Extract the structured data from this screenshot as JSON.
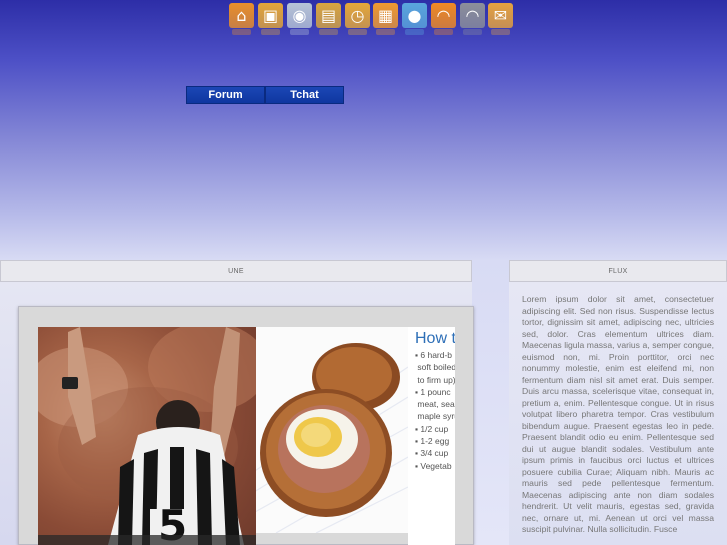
{
  "toolbar": {
    "icons": [
      {
        "name": "home-icon",
        "glyph": "⌂",
        "color": "#e98f2b"
      },
      {
        "name": "briefcase-icon",
        "glyph": "▣",
        "color": "#e3a63a"
      },
      {
        "name": "cd-icon",
        "glyph": "◉",
        "color": "#b7c4d6"
      },
      {
        "name": "clapperboard-icon",
        "glyph": "▤",
        "color": "#d9a640"
      },
      {
        "name": "clock-icon",
        "glyph": "◷",
        "color": "#e5a83a"
      },
      {
        "name": "calendar-icon",
        "glyph": "▦",
        "color": "#ef9a31"
      },
      {
        "name": "chat-bubble-icon",
        "glyph": "●",
        "color": "#5aa6dd"
      },
      {
        "name": "rss-icon",
        "glyph": "◠",
        "color": "#f08a24"
      },
      {
        "name": "feed-icon",
        "glyph": "◠",
        "color": "#8c8f9a"
      },
      {
        "name": "mail-icon",
        "glyph": "✉",
        "color": "#e6a33f"
      }
    ]
  },
  "nav": {
    "forum": "Forum",
    "tchat": "Tchat"
  },
  "une": {
    "header": "UNE",
    "article": {
      "title": "How to",
      "ingredients": [
        "6 hard-b",
        "soft boiled",
        "to firm up)",
        "1 pounc",
        "meat, seas",
        "maple syru",
        "1/2 cup",
        "1-2 egg",
        "3/4 cup",
        "Vegetab"
      ]
    },
    "referee_number": "5"
  },
  "flux": {
    "header": "FLUX",
    "text": "Lorem ipsum dolor sit amet, consectetuer adipiscing elit. Sed non risus. Suspendisse lectus tortor, dignissim sit amet, adipiscing nec, ultricies sed, dolor. Cras elementum ultrices diam. Maecenas ligula massa, varius a, semper congue, euismod non, mi. Proin porttitor, orci nec nonummy molestie, enim est eleifend mi, non fermentum diam nisl sit amet erat. Duis semper. Duis arcu massa, scelerisque vitae, consequat in, pretium a, enim. Pellentesque congue. Ut in risus volutpat libero pharetra tempor. Cras vestibulum bibendum augue. Praesent egestas leo in pede. Praesent blandit odio eu enim. Pellentesque sed dui ut augue blandit sodales. Vestibulum ante ipsum primis in faucibus orci luctus et ultrices posuere cubilia Curae; Aliquam nibh. Mauris ac mauris sed pede pellentesque fermentum. Maecenas adipiscing ante non diam sodales hendrerit. Ut velit mauris, egestas sed, gravida nec, ornare ut, mi. Aenean ut orci vel massa suscipit pulvinar. Nulla sollicitudin. Fusce"
  }
}
